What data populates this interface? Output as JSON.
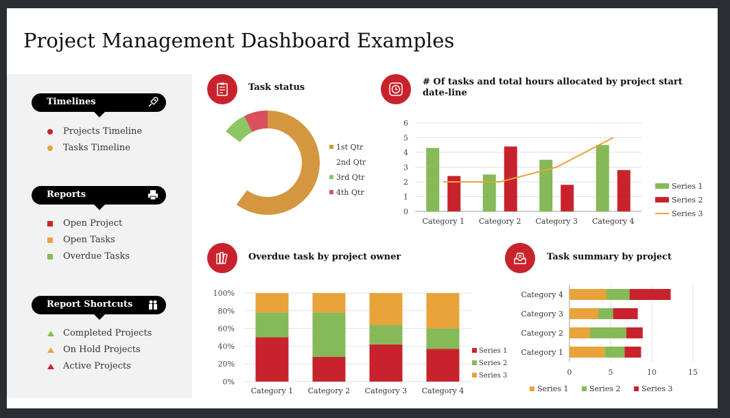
{
  "title": "Project Management Dashboard Examples",
  "colors": {
    "red": "#c8232c",
    "orange": "#e8a33a",
    "green": "#86b957",
    "donut_orange": "#d4963f",
    "donut_green": "#8dc664",
    "donut_red": "#d94f5c"
  },
  "sidebar": {
    "timelines": {
      "label": "Timelines",
      "icon": "rocket-icon",
      "items": [
        {
          "label": "Projects Timeline",
          "marker": "dot",
          "color": "#c8232c"
        },
        {
          "label": "Tasks Timeline",
          "marker": "dot",
          "color": "#e8a33a"
        }
      ]
    },
    "reports": {
      "label": "Reports",
      "icon": "printer-icon",
      "items": [
        {
          "label": "Open Project",
          "marker": "square",
          "color": "#c8232c"
        },
        {
          "label": "Open Tasks",
          "marker": "square",
          "color": "#e8a33a"
        },
        {
          "label": "Overdue Tasks",
          "marker": "square",
          "color": "#86b957"
        }
      ]
    },
    "shortcuts": {
      "label": "Report Shortcuts",
      "icon": "people-icon",
      "items": [
        {
          "label": "Completed Projects",
          "marker": "triangle",
          "color": "#86b957"
        },
        {
          "label": "On Hold Projects",
          "marker": "triangle",
          "color": "#e8a33a"
        },
        {
          "label": "Active Projects",
          "marker": "triangle",
          "color": "#c8232c"
        }
      ]
    }
  },
  "sections": {
    "task_status": {
      "title": "Task status",
      "icon": "clipboard-icon"
    },
    "tasks_hours": {
      "title": "# Of tasks and total hours allocated by project start date-line",
      "icon": "clock-icon"
    },
    "overdue": {
      "title": "Overdue task by project owner",
      "icon": "books-icon"
    },
    "summary": {
      "title": "Task summary by project",
      "icon": "inbox-icon"
    }
  },
  "chart_data": [
    {
      "type": "pie",
      "style": "donut",
      "categories": [
        "1st Qtr",
        "2nd Qtr",
        "3rd Qtr",
        "4th Qtr"
      ],
      "values": [
        6.5,
        2.7,
        0.8,
        0.8
      ],
      "colors": [
        "#d4963f",
        "none",
        "#8dc664",
        "#d94f5c"
      ],
      "legend": "right"
    },
    {
      "type": "bar",
      "subtype": "clustered-with-line",
      "categories": [
        "Category 1",
        "Category 2",
        "Category 3",
        "Category 4"
      ],
      "series": [
        {
          "name": "Series 1",
          "type": "bar",
          "color": "#86b957",
          "values": [
            4.3,
            2.5,
            3.5,
            4.5
          ]
        },
        {
          "name": "Series 2",
          "type": "bar",
          "color": "#c8232c",
          "values": [
            2.4,
            4.4,
            1.8,
            2.8
          ]
        },
        {
          "name": "Series 3",
          "type": "line",
          "color": "#e8a33a",
          "values": [
            2,
            2,
            3,
            5
          ]
        }
      ],
      "ylim": [
        0,
        6
      ],
      "yticks": [
        0,
        1,
        2,
        3,
        4,
        5,
        6
      ],
      "grid": true,
      "legend": "right"
    },
    {
      "type": "bar",
      "subtype": "stacked-100",
      "categories": [
        "Category 1",
        "Category 2",
        "Category 3",
        "Category 4"
      ],
      "series": [
        {
          "name": "Series 1",
          "color": "#c8232c",
          "values": [
            50,
            28,
            42,
            37
          ]
        },
        {
          "name": "Series 2",
          "color": "#86b957",
          "values": [
            28,
            50,
            22,
            23
          ]
        },
        {
          "name": "Series 3",
          "color": "#e8a33a",
          "values": [
            22,
            22,
            36,
            40
          ]
        }
      ],
      "yticks": [
        "0%",
        "20%",
        "40%",
        "60%",
        "80%",
        "100%"
      ],
      "grid": true,
      "legend": "right"
    },
    {
      "type": "bar",
      "subtype": "stacked-horizontal",
      "categories": [
        "Category 1",
        "Category 2",
        "Category 3",
        "Category 4"
      ],
      "series": [
        {
          "name": "Series 1",
          "color": "#e8a33a",
          "values": [
            4.3,
            2.5,
            3.5,
            4.5
          ]
        },
        {
          "name": "Series 2",
          "color": "#86b957",
          "values": [
            2.4,
            4.4,
            1.8,
            2.8
          ]
        },
        {
          "name": "Series 3",
          "color": "#c8232c",
          "values": [
            2,
            2,
            3,
            5
          ]
        }
      ],
      "xlim": [
        0,
        15
      ],
      "xticks": [
        0,
        5,
        10,
        15
      ],
      "grid": true,
      "legend": "bottom"
    }
  ]
}
